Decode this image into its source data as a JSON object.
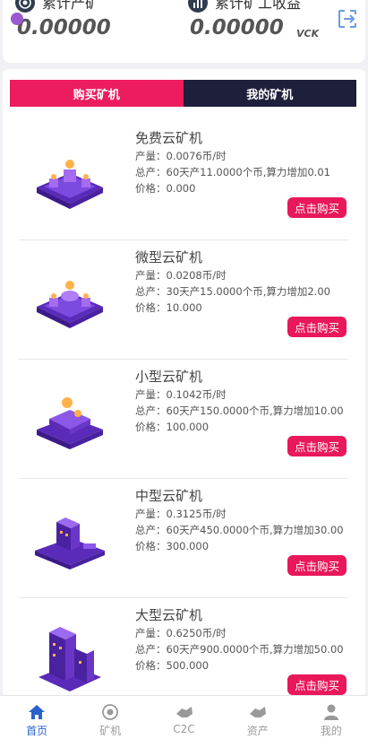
{
  "stats": {
    "left": {
      "label": "累计产矿",
      "value": "0.00000"
    },
    "right": {
      "label": "累计矿工收益",
      "value": "0.00000",
      "unit": "VCK"
    }
  },
  "tabs": [
    {
      "label": "购买矿机",
      "active": true
    },
    {
      "label": "我的矿机",
      "active": false
    }
  ],
  "miners": [
    {
      "name": "免费云矿机",
      "output": "产量：0.0076币/时",
      "total": "总产：60天产11.0000个币,算力增加0.01",
      "price": "价格：0.000",
      "button": "点击购买"
    },
    {
      "name": "微型云矿机",
      "output": "产量：0.0208币/时",
      "total": "总产：30天产15.0000个币,算力增加2.00",
      "price": "价格：10.000",
      "button": "点击购买"
    },
    {
      "name": "小型云矿机",
      "output": "产量：0.1042币/时",
      "total": "总产：60天产150.0000个币,算力增加10.00",
      "price": "价格：100.000",
      "button": "点击购买"
    },
    {
      "name": "中型云矿机",
      "output": "产量：0.3125币/时",
      "total": "总产：60天产450.0000个币,算力增加30.00",
      "price": "价格：300.000",
      "button": "点击购买"
    },
    {
      "name": "大型云矿机",
      "output": "产量：0.6250币/时",
      "total": "总产：60天产900.0000个币,算力增加50.00",
      "price": "价格：500.000",
      "button": "点击购买"
    }
  ],
  "nav": [
    {
      "label": "首页",
      "icon": "home-icon",
      "active": true
    },
    {
      "label": "矿机",
      "icon": "miner-icon",
      "active": false
    },
    {
      "label": "C2C",
      "icon": "c2c-icon",
      "active": false
    },
    {
      "label": "资产",
      "icon": "assets-icon",
      "active": false
    },
    {
      "label": "我的",
      "icon": "user-icon",
      "active": false
    }
  ],
  "colors": {
    "accent": "#e8185a",
    "dark_tab": "#1e1f3b",
    "nav_active": "#2a63c9",
    "purple": "#7a3fd6"
  }
}
